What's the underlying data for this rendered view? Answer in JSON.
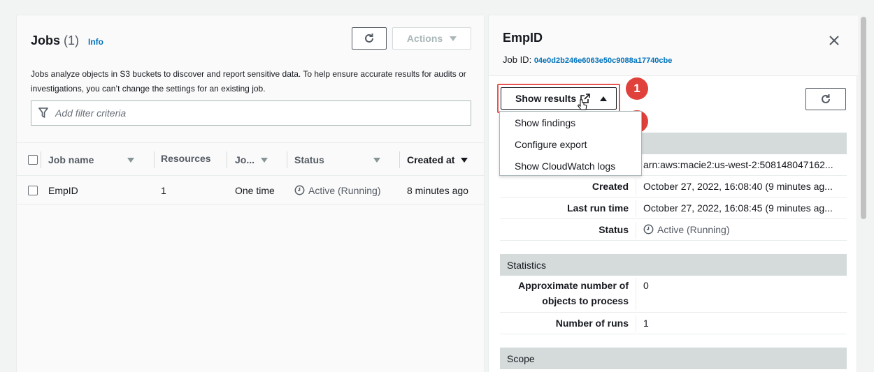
{
  "jobs_panel": {
    "title": "Jobs",
    "count": "(1)",
    "info_link": "Info",
    "actions_label": "Actions",
    "description": "Jobs analyze objects in S3 buckets to discover and report sensitive data. To help ensure accurate results for audits or investigations, you can’t change the settings for an existing job.",
    "filter_placeholder": "Add filter criteria",
    "columns": [
      "Job name",
      "Resources",
      "Jo...",
      "Status",
      "Created at"
    ],
    "rows": [
      {
        "name": "EmpID",
        "resources": "1",
        "type": "One time",
        "status": "Active (Running)",
        "created": "8 minutes ago"
      }
    ]
  },
  "detail_panel": {
    "title": "EmpID",
    "job_id_label": "Job ID:",
    "job_id": "04e0d2b246e6063e50c9088a17740cbe",
    "show_results_label": "Show results",
    "dropdown_items": [
      "Show findings",
      "Configure export",
      "Show CloudWatch logs"
    ],
    "badges": [
      "1",
      "2"
    ],
    "general": {
      "arn": "arn:aws:macie2:us-west-2:508148047162...",
      "rows": [
        {
          "key": "Created",
          "value": "October 27, 2022, 16:08:40 (9 minutes ag..."
        },
        {
          "key": "Last run time",
          "value": "October 27, 2022, 16:08:45 (9 minutes ag..."
        },
        {
          "key": "Status",
          "value": "Active (Running)"
        }
      ]
    },
    "statistics": {
      "heading": "Statistics",
      "rows": [
        {
          "key": "Approximate number of objects to process",
          "value": "0"
        },
        {
          "key": "Number of runs",
          "value": "1"
        }
      ]
    },
    "scope": {
      "heading": "Scope"
    }
  },
  "colors": {
    "link": "#0073bb",
    "badge": "#e0413a",
    "highlight": "#e8554e",
    "section": "#d5dbdb"
  }
}
